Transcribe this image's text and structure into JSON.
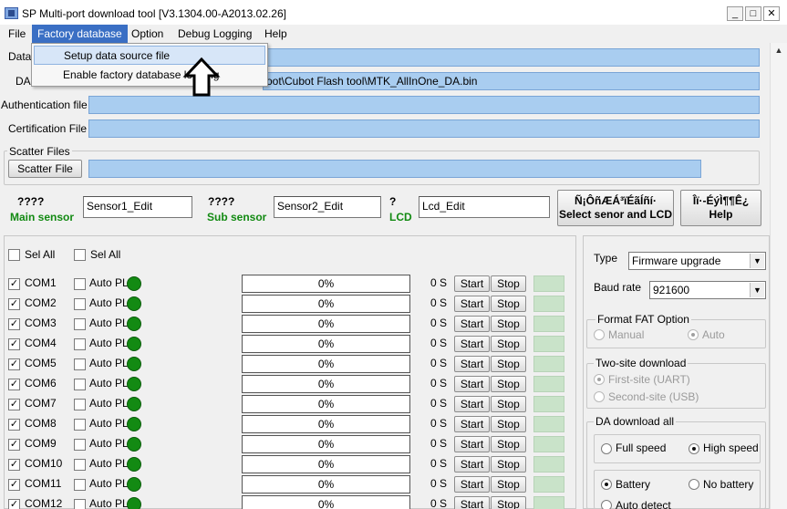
{
  "window": {
    "title": "SP Multi-port download tool [V3.1304.00-A2013.02.26]",
    "minimize": "_",
    "maximize": "□",
    "close": "✕"
  },
  "menu": {
    "items": [
      "File",
      "Factory database",
      "Option",
      "Debug Logging",
      "Help"
    ],
    "active": "Factory database",
    "dropdown": [
      "Setup data source file",
      "Enable factory database logging"
    ]
  },
  "files": {
    "data_label": "Data",
    "da_label": "DA",
    "da_path": "oot\\Cubot Flash tool\\MTK_AllInOne_DA.bin",
    "auth_label": "Authentication file",
    "cert_label": "Certification File",
    "scatter_group": "Scatter Files",
    "scatter_button": "Scatter File"
  },
  "sensors": {
    "main_q": "????",
    "main_label": "Main sensor",
    "main_edit": "Sensor1_Edit",
    "sub_q": "????",
    "sub_label": "Sub sensor",
    "sub_edit": "Sensor2_Edit",
    "lcd_q": "?",
    "lcd_label": "LCD",
    "lcd_edit": "Lcd_Edit",
    "select_btn_line1": "Ñ¡ÔñÆÁ³ïÉãÍñí·",
    "select_btn_line2": "Select senor and LCD",
    "help_btn_line1": "Îï·-ÉýÌ¶¶Ê¿",
    "help_btn_line2": "Help"
  },
  "ports": {
    "sel_all_1": "Sel All",
    "sel_all_2": "Sel All",
    "auto_label": "Auto PL",
    "start_label": "Start",
    "stop_label": "Stop",
    "rows": [
      {
        "com": "COM1",
        "progress": "0%",
        "time": "0 S"
      },
      {
        "com": "COM2",
        "progress": "0%",
        "time": "0 S"
      },
      {
        "com": "COM3",
        "progress": "0%",
        "time": "0 S"
      },
      {
        "com": "COM4",
        "progress": "0%",
        "time": "0 S"
      },
      {
        "com": "COM5",
        "progress": "0%",
        "time": "0 S"
      },
      {
        "com": "COM6",
        "progress": "0%",
        "time": "0 S"
      },
      {
        "com": "COM7",
        "progress": "0%",
        "time": "0 S"
      },
      {
        "com": "COM8",
        "progress": "0%",
        "time": "0 S"
      },
      {
        "com": "COM9",
        "progress": "0%",
        "time": "0 S"
      },
      {
        "com": "COM10",
        "progress": "0%",
        "time": "0 S"
      },
      {
        "com": "COM11",
        "progress": "0%",
        "time": "0 S"
      },
      {
        "com": "COM12",
        "progress": "0%",
        "time": "0 S"
      }
    ]
  },
  "settings": {
    "type_label": "Type",
    "type_value": "Firmware upgrade",
    "baud_label": "Baud rate",
    "baud_value": "921600",
    "fat_group": "Format FAT Option",
    "fat_manual": "Manual",
    "fat_auto": "Auto",
    "two_site_group": "Two-site download",
    "first_site": "First-site (UART)",
    "second_site": "Second-site (USB)",
    "da_group": "DA download all",
    "full_speed": "Full speed",
    "high_speed": "High speed",
    "battery": "Battery",
    "no_battery": "No battery",
    "auto_detect": "Auto detect"
  },
  "colors": {
    "menu_active": "#3a6fc4",
    "field_fill": "#a9cdf0",
    "status_green": "#138a13",
    "sensor_green": "#128a12"
  }
}
